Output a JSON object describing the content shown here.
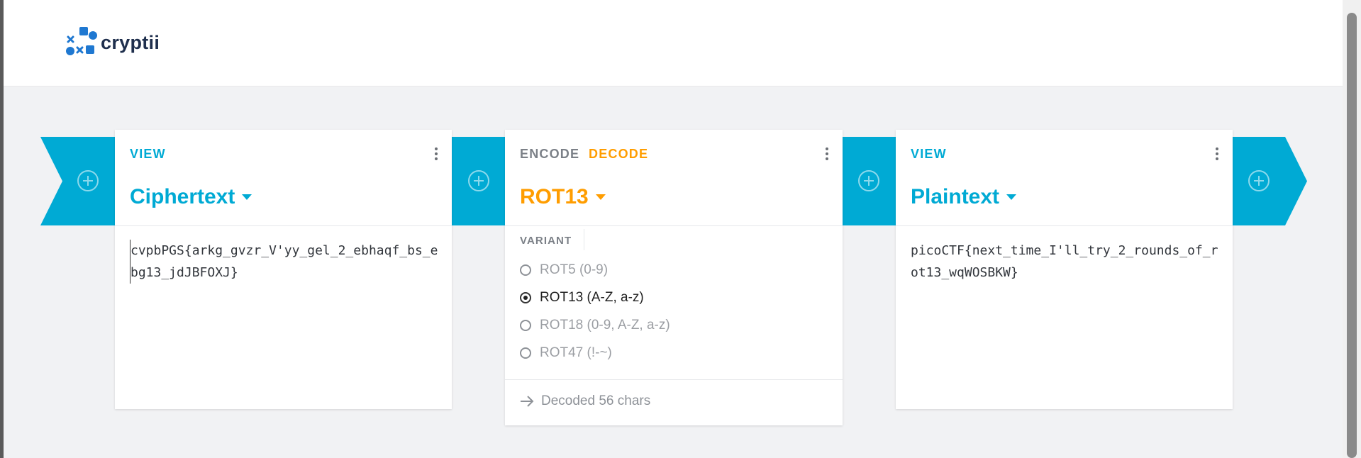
{
  "brand": {
    "name": "cryptii",
    "logo_icon": "cryptii-logo-icon"
  },
  "colors": {
    "accent_blue": "#00aad4",
    "accent_orange": "#ff9d00",
    "text_dark": "#222222",
    "muted": "#8d9197"
  },
  "cards": {
    "ciphertext": {
      "tab": "VIEW",
      "title": "Ciphertext",
      "content": "cvpbPGS{arkg_gvzr_V'yy_gel_2_ebhaqf_bs_ebg13_jdJBFOXJ}"
    },
    "rot13": {
      "tab_encode": "ENCODE",
      "tab_decode": "DECODE",
      "title": "ROT13",
      "variant_label": "VARIANT",
      "variants": [
        {
          "label": "ROT5 (0-9)",
          "selected": false
        },
        {
          "label": "ROT13 (A-Z, a-z)",
          "selected": true
        },
        {
          "label": "ROT18 (0-9, A-Z, a-z)",
          "selected": false
        },
        {
          "label": "ROT47 (!-~)",
          "selected": false
        }
      ],
      "status": "Decoded 56 chars"
    },
    "plaintext": {
      "tab": "VIEW",
      "title": "Plaintext",
      "content": "picoCTF{next_time_I'll_try_2_rounds_of_rot13_wqWOSBKW}"
    }
  }
}
